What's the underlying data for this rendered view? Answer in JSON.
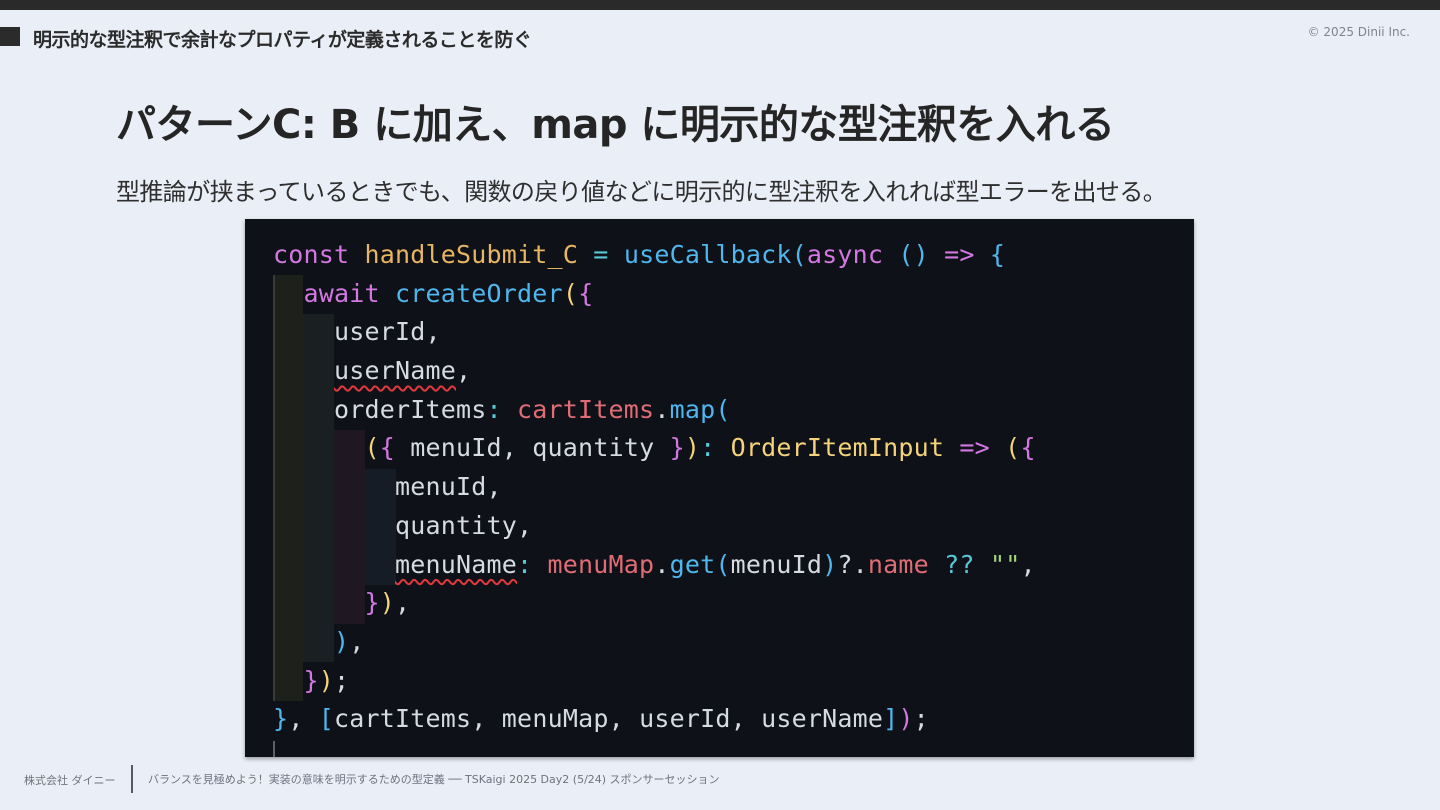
{
  "header": {
    "section_label": "明示的な型注釈で余計なプロパティが定義されることを防ぐ",
    "copyright": "© 2025 Dinii Inc."
  },
  "slide": {
    "title": "パターンC: B に加え、map に明示的な型注釈を入れる",
    "subtitle": "型推論が挟まっているときでも、関数の戻り値などに明示的に型注釈を入れれば型エラーを出せる。"
  },
  "colors": {
    "keyword": "#d477e3",
    "function_name": "#e8b562",
    "call": "#4fb6ee",
    "operator": "#56c8d8",
    "variable": "#e06c75",
    "type": "#f4d27a",
    "string": "#a2d57b",
    "plain": "#d6dbe2",
    "error_squiggle": "#e0393e"
  },
  "code": {
    "lines": [
      [
        {
          "t": "const ",
          "c": "keyword"
        },
        {
          "t": "handleSubmit_C",
          "c": "function_name"
        },
        {
          "t": " = ",
          "c": "operator"
        },
        {
          "t": "useCallback",
          "c": "call"
        },
        {
          "t": "(",
          "c": "call"
        },
        {
          "t": "async",
          "c": "keyword"
        },
        {
          "t": " () ",
          "c": "call"
        },
        {
          "t": "=>",
          "c": "keyword"
        },
        {
          "t": " {",
          "c": "call"
        }
      ],
      [
        {
          "t": "  "
        },
        {
          "t": "await",
          "c": "keyword"
        },
        {
          "t": " "
        },
        {
          "t": "createOrder",
          "c": "call"
        },
        {
          "t": "(",
          "c": "type"
        },
        {
          "t": "{",
          "c": "keyword"
        }
      ],
      [
        {
          "t": "    userId,",
          "c": "plain"
        }
      ],
      [
        {
          "t": "    "
        },
        {
          "t": "userName",
          "c": "plain",
          "err": true
        },
        {
          "t": ",",
          "c": "plain"
        }
      ],
      [
        {
          "t": "    orderItems",
          "c": "plain"
        },
        {
          "t": ": ",
          "c": "operator"
        },
        {
          "t": "cartItems",
          "c": "variable"
        },
        {
          "t": ".",
          "c": "plain"
        },
        {
          "t": "map",
          "c": "call"
        },
        {
          "t": "(",
          "c": "call"
        }
      ],
      [
        {
          "t": "      "
        },
        {
          "t": "(",
          "c": "type"
        },
        {
          "t": "{",
          "c": "keyword"
        },
        {
          "t": " menuId, quantity ",
          "c": "plain"
        },
        {
          "t": "}",
          "c": "keyword"
        },
        {
          "t": ")",
          "c": "type"
        },
        {
          "t": ": ",
          "c": "operator"
        },
        {
          "t": "OrderItemInput",
          "c": "type"
        },
        {
          "t": " => ",
          "c": "keyword"
        },
        {
          "t": "(",
          "c": "type"
        },
        {
          "t": "{",
          "c": "keyword"
        }
      ],
      [
        {
          "t": "        menuId,",
          "c": "plain"
        }
      ],
      [
        {
          "t": "        quantity,",
          "c": "plain"
        }
      ],
      [
        {
          "t": "        "
        },
        {
          "t": "menuName",
          "c": "plain",
          "err": true
        },
        {
          "t": ": ",
          "c": "operator"
        },
        {
          "t": "menuMap",
          "c": "variable"
        },
        {
          "t": ".",
          "c": "plain"
        },
        {
          "t": "get",
          "c": "call"
        },
        {
          "t": "(",
          "c": "call"
        },
        {
          "t": "menuId",
          "c": "plain"
        },
        {
          "t": ")",
          "c": "call"
        },
        {
          "t": "?.",
          "c": "plain"
        },
        {
          "t": "name",
          "c": "variable"
        },
        {
          "t": " ?? ",
          "c": "operator"
        },
        {
          "t": "\"\"",
          "c": "string"
        },
        {
          "t": ",",
          "c": "plain"
        }
      ],
      [
        {
          "t": "      "
        },
        {
          "t": "}",
          "c": "keyword"
        },
        {
          "t": ")",
          "c": "type"
        },
        {
          "t": ",",
          "c": "plain"
        }
      ],
      [
        {
          "t": "    "
        },
        {
          "t": ")",
          "c": "call"
        },
        {
          "t": ",",
          "c": "plain"
        }
      ],
      [
        {
          "t": "  "
        },
        {
          "t": "}",
          "c": "keyword"
        },
        {
          "t": ")",
          "c": "type"
        },
        {
          "t": ";",
          "c": "plain"
        }
      ],
      [
        {
          "t": "}",
          "c": "call"
        },
        {
          "t": ", ",
          "c": "plain"
        },
        {
          "t": "[",
          "c": "call"
        },
        {
          "t": "cartItems, menuMap, userId, userName",
          "c": "plain"
        },
        {
          "t": "]",
          "c": "call"
        },
        {
          "t": ")",
          "c": "keyword"
        },
        {
          "t": ";",
          "c": "plain"
        }
      ]
    ]
  },
  "footer": {
    "company": "株式会社 ダイニー",
    "event": "バランスを見極めよう！実装の意味を明示するための型定義 ── TSKaigi 2025 Day2 (5/24) スポンサーセッション"
  }
}
